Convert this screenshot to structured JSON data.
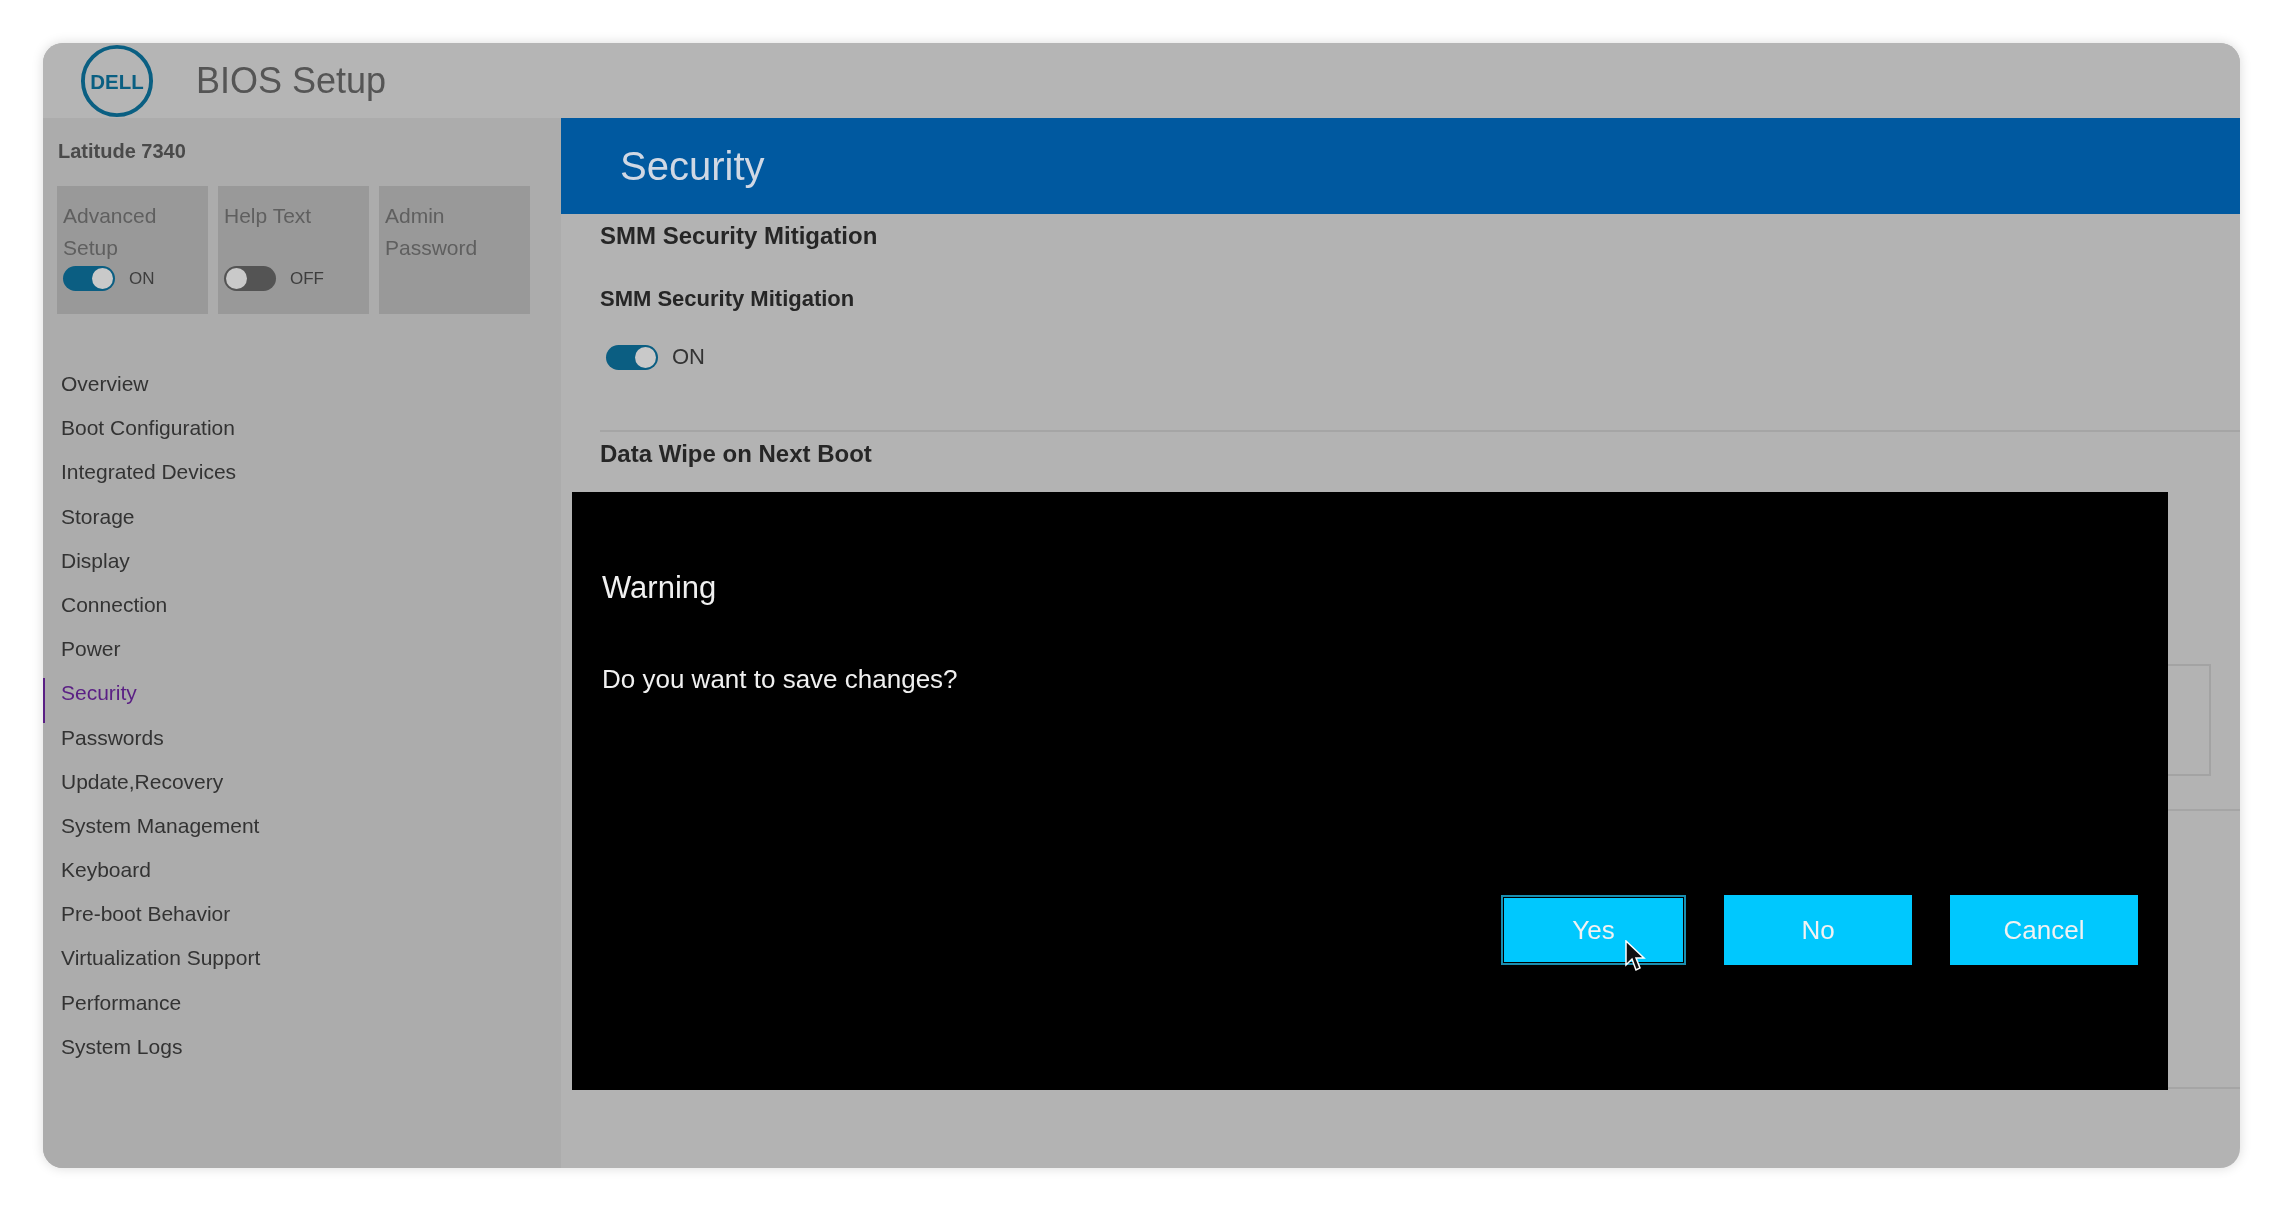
{
  "header": {
    "logo": "DELL",
    "title": "BIOS Setup"
  },
  "sidebar": {
    "model": "Latitude 7340",
    "tiles": [
      {
        "kind": "toggle",
        "label": "Advanced Setup",
        "on": true,
        "state_text": "ON"
      },
      {
        "kind": "toggle",
        "label": "Help Text",
        "on": false,
        "state_text": "OFF"
      },
      {
        "kind": "plain",
        "label": "Admin Password"
      }
    ],
    "items": [
      {
        "label": "Overview",
        "selected": false
      },
      {
        "label": "Boot Configuration",
        "selected": false
      },
      {
        "label": "Integrated Devices",
        "selected": false
      },
      {
        "label": "Storage",
        "selected": false
      },
      {
        "label": "Display",
        "selected": false
      },
      {
        "label": "Connection",
        "selected": false
      },
      {
        "label": "Power",
        "selected": false
      },
      {
        "label": "Security",
        "selected": true
      },
      {
        "label": "Passwords",
        "selected": false
      },
      {
        "label": "Update,Recovery",
        "selected": false
      },
      {
        "label": "System Management",
        "selected": false
      },
      {
        "label": "Keyboard",
        "selected": false
      },
      {
        "label": "Pre-boot Behavior",
        "selected": false
      },
      {
        "label": "Virtualization Support",
        "selected": false
      },
      {
        "label": "Performance",
        "selected": false
      },
      {
        "label": "System Logs",
        "selected": false
      }
    ]
  },
  "main": {
    "title": "Security",
    "sections": [
      {
        "heading": "SMM Security Mitigation",
        "setting": "SMM Security Mitigation",
        "on": true,
        "state_text": "ON"
      },
      {
        "heading": "Data Wipe on Next Boot"
      }
    ]
  },
  "dialog": {
    "title": "Warning",
    "message": "Do you want to save changes?",
    "buttons": [
      {
        "label": "Yes",
        "focused": true
      },
      {
        "label": "No",
        "focused": false
      },
      {
        "label": "Cancel",
        "focused": false
      }
    ]
  }
}
